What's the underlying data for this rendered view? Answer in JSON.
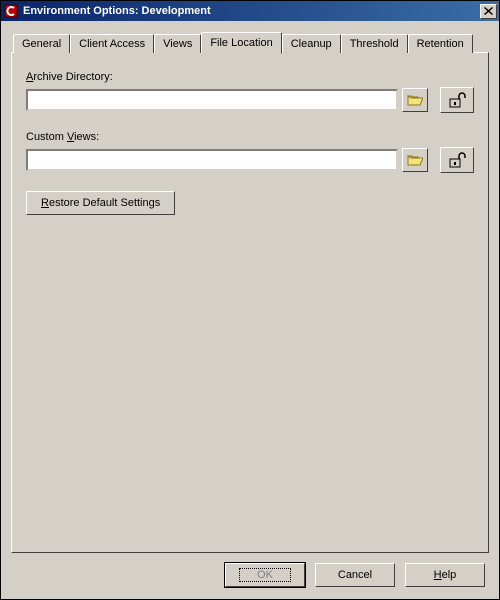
{
  "window": {
    "title": "Environment Options:  Development"
  },
  "tabs": {
    "list": [
      {
        "label": "General"
      },
      {
        "label": "Client Access"
      },
      {
        "label": "Views"
      },
      {
        "label": "File Location"
      },
      {
        "label": "Cleanup"
      },
      {
        "label": "Threshold"
      },
      {
        "label": "Retention"
      }
    ],
    "activeIndex": 3
  },
  "fields": {
    "archive": {
      "label_pre": "",
      "label_mn": "A",
      "label_post": "rchive Directory:",
      "value": ""
    },
    "customViews": {
      "label_pre": "Custom ",
      "label_mn": "V",
      "label_post": "iews:",
      "value": ""
    }
  },
  "buttons": {
    "restore_pre": "",
    "restore_mn": "R",
    "restore_post": "estore Default Settings",
    "ok": "OK",
    "cancel": "Cancel",
    "help_pre": "",
    "help_mn": "H",
    "help_post": "elp"
  },
  "icons": {
    "folder": "folder-open-icon",
    "unlock": "unlock-icon"
  }
}
